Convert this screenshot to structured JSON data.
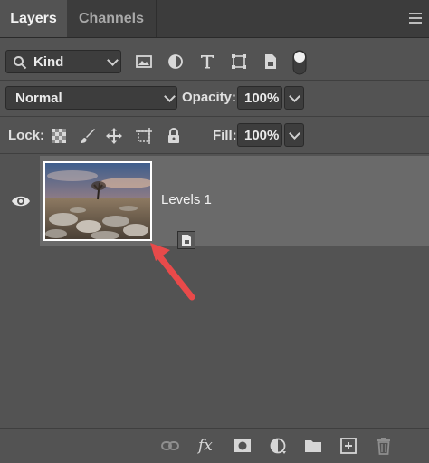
{
  "tabs": [
    {
      "label": "Layers",
      "active": true
    },
    {
      "label": "Channels",
      "active": false
    }
  ],
  "filter": {
    "kind_label": "Kind",
    "icons": [
      "image-filter-icon",
      "adjustment-filter-icon",
      "type-filter-icon",
      "shape-filter-icon",
      "smart-object-filter-icon",
      "filter-toggle-icon"
    ]
  },
  "blend": {
    "mode": "Normal",
    "opacity_label": "Opacity:",
    "opacity_value": "100%"
  },
  "lock": {
    "label": "Lock:",
    "fill_label": "Fill:",
    "fill_value": "100%",
    "icons": [
      "lock-transparent-pixels-icon",
      "lock-image-pixels-icon",
      "lock-position-icon",
      "lock-artboard-icon",
      "lock-all-icon"
    ]
  },
  "layers": [
    {
      "name": "Levels 1",
      "visible": true,
      "selected": true
    }
  ],
  "colors": {
    "panel_bg": "#535353",
    "selected_row": "#6a6a6a",
    "arrow": "#e84a4a"
  },
  "bottom_icons": [
    "link-layers-icon",
    "fx-icon",
    "add-mask-icon",
    "new-adjustment-icon",
    "new-group-icon",
    "new-layer-icon",
    "delete-icon"
  ],
  "fx_label": "fx"
}
